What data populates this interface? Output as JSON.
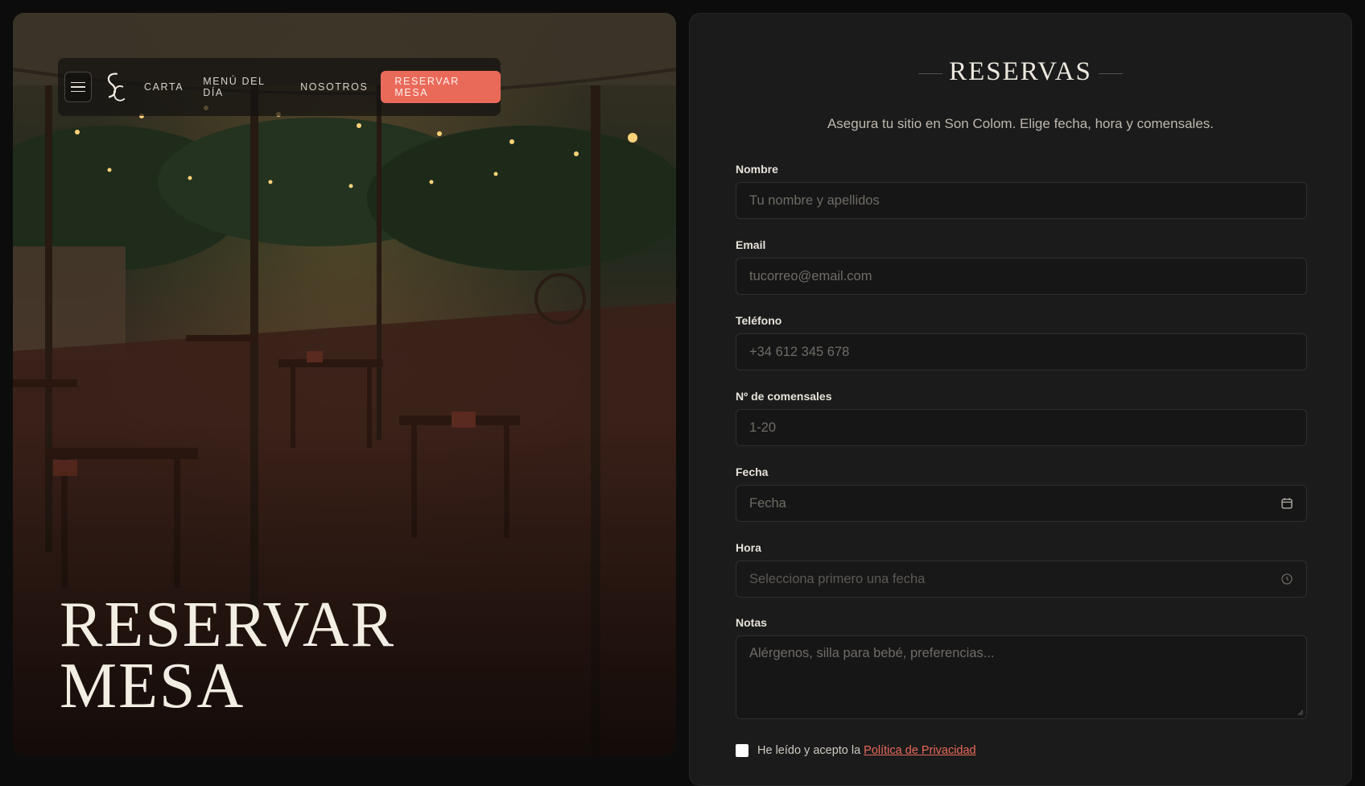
{
  "nav": {
    "menu_icon": "hamburger-icon",
    "logo_text": "SC",
    "links": [
      "CARTA",
      "MENÚ DEL DÍA",
      "NOSOTROS"
    ],
    "cta_label": "RESERVAR MESA"
  },
  "hero": {
    "title_line1": "RESERVAR",
    "title_line2": "MESA"
  },
  "form": {
    "heading": "RESERVAS",
    "subtitle": "Asegura tu sitio en Son Colom. Elige fecha, hora y comensales.",
    "fields": [
      {
        "label": "Nombre",
        "placeholder": "Tu nombre y apellidos"
      },
      {
        "label": "Email",
        "placeholder": "tucorreo@email.com"
      },
      {
        "label": "Teléfono",
        "placeholder": "+34 612 345 678"
      },
      {
        "label": "Nº de comensales",
        "placeholder": "1-20"
      },
      {
        "label": "Fecha",
        "placeholder": "Fecha",
        "icon": "calendar-icon"
      },
      {
        "label": "Hora",
        "placeholder": "Selecciona primero una fecha",
        "icon": "clock-icon"
      },
      {
        "label": "Notas",
        "placeholder": "Alérgenos, silla para bebé, preferencias..."
      }
    ],
    "consent_text": "He leído y acepto la",
    "consent_link": "Política de Privacidad"
  },
  "colors": {
    "accent": "#ea6a5a",
    "panel": "#1b1b1b",
    "background": "#0c0c0c"
  }
}
